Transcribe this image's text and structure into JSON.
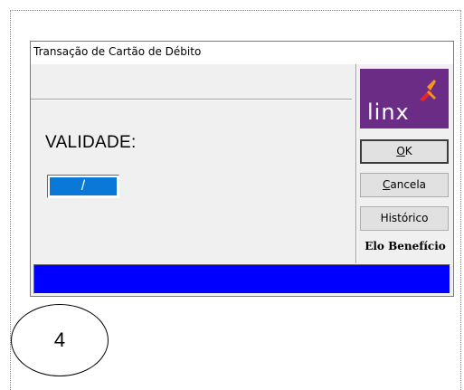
{
  "dialog": {
    "title": "Transação de Cartão de Débito",
    "field_label": "VALIDADE:",
    "date_value": "/",
    "status_text": ""
  },
  "logo": {
    "text": "linx",
    "brand_color": "#6b2c86",
    "accent_colors": [
      "#f7941d",
      "#e8242d"
    ]
  },
  "buttons": {
    "ok_label": "OK",
    "cancel_label": "Cancela",
    "history_label": "Histórico"
  },
  "brand_label": "Elo Benefício",
  "annotation": {
    "step_number": "4"
  },
  "colors": {
    "status_bar": "#0000ff",
    "field_highlight": "#0a78d7",
    "dialog_bg": "#f0f0f0"
  }
}
